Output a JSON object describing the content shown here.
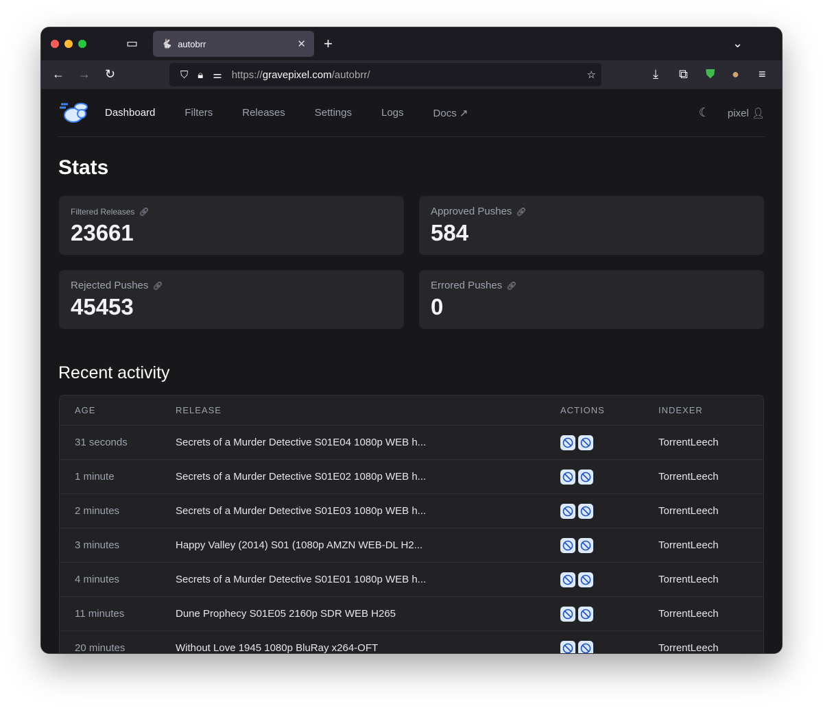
{
  "browser": {
    "tab_title": "autobrr",
    "url_prefix": "https://",
    "url_domain": "gravepixel.com",
    "url_path": "/autobrr/"
  },
  "nav": {
    "items": [
      "Dashboard",
      "Filters",
      "Releases",
      "Settings",
      "Logs",
      "Docs"
    ],
    "user": "pixel"
  },
  "stats": {
    "title": "Stats",
    "cards": [
      {
        "label": "Filtered Releases",
        "value": "23661"
      },
      {
        "label": "Approved Pushes",
        "value": "584"
      },
      {
        "label": "Rejected Pushes",
        "value": "45453"
      },
      {
        "label": "Errored Pushes",
        "value": "0"
      }
    ]
  },
  "activity": {
    "title": "Recent activity",
    "columns": [
      "AGE",
      "RELEASE",
      "ACTIONS",
      "INDEXER"
    ],
    "rows": [
      {
        "age": "31 seconds",
        "release": "Secrets of a Murder Detective S01E04 1080p WEB h...",
        "indexer": "TorrentLeech"
      },
      {
        "age": "1 minute",
        "release": "Secrets of a Murder Detective S01E02 1080p WEB h...",
        "indexer": "TorrentLeech"
      },
      {
        "age": "2 minutes",
        "release": "Secrets of a Murder Detective S01E03 1080p WEB h...",
        "indexer": "TorrentLeech"
      },
      {
        "age": "3 minutes",
        "release": "Happy Valley (2014) S01 (1080p AMZN WEB-DL H2...",
        "indexer": "TorrentLeech"
      },
      {
        "age": "4 minutes",
        "release": "Secrets of a Murder Detective S01E01 1080p WEB h...",
        "indexer": "TorrentLeech"
      },
      {
        "age": "11 minutes",
        "release": "Dune Prophecy S01E05 2160p SDR WEB H265",
        "indexer": "TorrentLeech"
      },
      {
        "age": "20 minutes",
        "release": "Without Love 1945 1080p BluRay x264-OFT",
        "indexer": "TorrentLeech"
      }
    ]
  },
  "colors": {
    "action_rejected": "#1d4ed8",
    "action_bg": "#dbeafe"
  }
}
